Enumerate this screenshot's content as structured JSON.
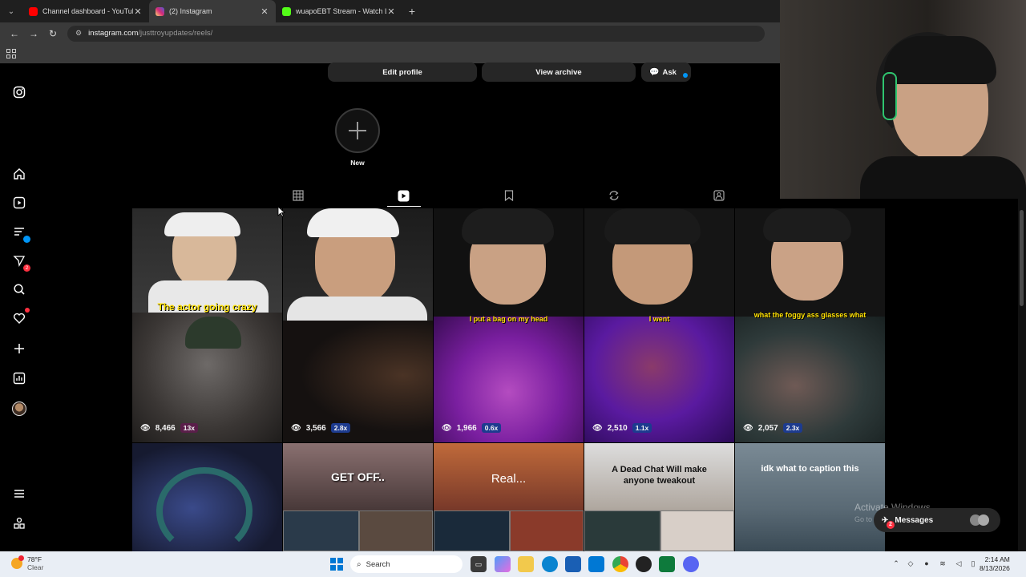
{
  "browser": {
    "tabs": [
      {
        "label": "Channel dashboard - YouTube",
        "icon": "youtube-icon",
        "color": "#ff0000"
      },
      {
        "label": "(2) Instagram",
        "icon": "instagram-icon",
        "color": "#d6249f"
      },
      {
        "label": "wuapoEBT Stream - Watch Live",
        "icon": "kick-icon",
        "color": "#53fc18"
      }
    ],
    "close_glyph": "✕",
    "new_tab_glyph": "+",
    "url_host": "instagram.com",
    "url_path": "/justtroyupdates/reels/"
  },
  "sidebar": {
    "items": [
      {
        "name": "instagram-logo-icon",
        "badge": ""
      },
      {
        "name": "home-icon",
        "badge": ""
      },
      {
        "name": "reels-icon",
        "badge": ""
      },
      {
        "name": "explore-icon",
        "badge": ""
      },
      {
        "name": "messages-icon",
        "badge": "2"
      },
      {
        "name": "search-icon",
        "badge": ""
      },
      {
        "name": "notifications-heart-icon",
        "badge": ""
      },
      {
        "name": "create-plus-icon",
        "badge": ""
      },
      {
        "name": "dashboard-icon",
        "badge": ""
      },
      {
        "name": "profile-avatar",
        "badge": ""
      },
      {
        "name": "more-menu-icon",
        "badge": ""
      },
      {
        "name": "also-from-meta-icon",
        "badge": ""
      }
    ]
  },
  "profile": {
    "edit_profile": "Edit profile",
    "view_archive": "View archive",
    "ask": "Ask",
    "new_label": "New"
  },
  "profile_tabs": [
    "grid-icon",
    "reels-tab-icon",
    "saved-icon",
    "reposts-icon",
    "tagged-icon"
  ],
  "reels": [
    {
      "caption_top": "",
      "caption_mid": "The actor going crazy",
      "views": "8,466",
      "multiplier": "13x",
      "style": "pink"
    },
    {
      "caption_top": "",
      "caption_mid": "",
      "views": "3,566",
      "multiplier": "2.8x",
      "style": "blue"
    },
    {
      "caption_top": "",
      "caption_mid": "I put a bag on my head",
      "views": "1,966",
      "multiplier": "0.6x",
      "style": "blue"
    },
    {
      "caption_top": "",
      "caption_mid": "I went",
      "views": "2,510",
      "multiplier": "1.1x",
      "style": "blue"
    },
    {
      "caption_top": "",
      "caption_mid": "what the foggy ass glasses what",
      "views": "2,057",
      "multiplier": "2.3x",
      "style": "blue"
    },
    {
      "caption_top": "",
      "caption_mid": "",
      "views": "",
      "multiplier": "",
      "style": ""
    },
    {
      "caption_top": "GET OFF..",
      "caption_mid": "",
      "views": "",
      "multiplier": "",
      "style": ""
    },
    {
      "caption_top": "Real...",
      "caption_mid": "",
      "views": "",
      "multiplier": "",
      "style": ""
    },
    {
      "caption_top": "A Dead Chat Will make anyone tweakout",
      "caption_mid": "",
      "views": "",
      "multiplier": "",
      "style": ""
    },
    {
      "caption_top": "idk what to caption this",
      "caption_mid": "",
      "views": "",
      "multiplier": "",
      "style": ""
    }
  ],
  "overlay": {
    "activate_title": "Activate Windows",
    "activate_sub": "Go to Settings to activate Windows.",
    "messages_label": "Messages",
    "messages_badge": "2"
  },
  "taskbar": {
    "temperature": "78°F",
    "condition": "Clear",
    "search_placeholder": "Search",
    "time": "2:14 AM",
    "date": "8/13/2026"
  },
  "colors": {
    "accent_blue": "#0095f6",
    "badge_red": "#ff3040"
  }
}
